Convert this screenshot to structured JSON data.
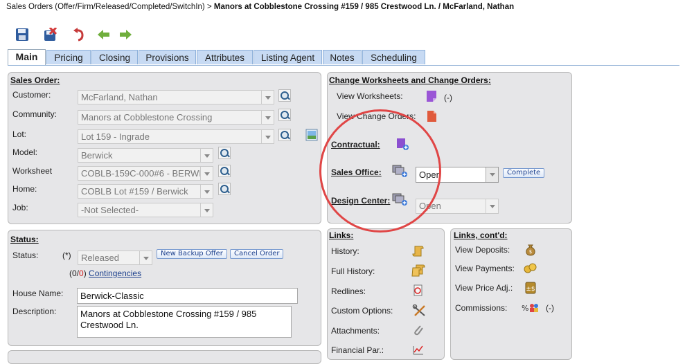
{
  "breadcrumb": {
    "prefix": "Sales Orders (Offer/Firm/Released/Completed/SwitchIn)",
    "sep": ">",
    "current": "Manors at Cobblestone Crossing #159 / 985 Crestwood Ln. / McFarland, Nathan"
  },
  "toolbar": {
    "icons": [
      "save-icon",
      "save-close-icon",
      "undo-icon",
      "back-arrow-icon",
      "forward-arrow-icon"
    ]
  },
  "tabs": [
    "Main",
    "Pricing",
    "Closing",
    "Provisions",
    "Attributes",
    "Listing Agent",
    "Notes",
    "Scheduling"
  ],
  "sales_order": {
    "title": "Sales Order:",
    "customer_label": "Customer:",
    "customer_value": "McFarland, Nathan",
    "community_label": "Community:",
    "community_value": "Manors at Cobblestone Crossing",
    "lot_label": "Lot:",
    "lot_value": "Lot 159 - Ingrade",
    "model_label": "Model:",
    "model_value": "Berwick",
    "worksheet_label": "Worksheet",
    "worksheet_value": "COBLB-159C-000#6 - BERWI(",
    "home_label": "Home:",
    "home_value": "COBLB Lot #159 / Berwick",
    "job_label": "Job:",
    "job_value": "-Not Selected-"
  },
  "status": {
    "title": "Status:",
    "status_label": "Status:",
    "required_mark": "(*)",
    "status_value": "Released",
    "new_backup_offer": "New Backup Offer",
    "cancel_order": "Cancel Order",
    "contingency_open": "(0/",
    "contingency_count": "0",
    "contingency_close": ")",
    "contingencies_link": "Contingencies",
    "house_name_label": "House Name:",
    "house_name_value": "Berwick-Classic",
    "description_label": "Description:",
    "description_value": "Manors at Cobblestone Crossing #159 / 985 Crestwood Ln."
  },
  "change": {
    "title": "Change Worksheets and Change Orders:",
    "view_worksheets": "View Worksheets:",
    "worksheets_count": "(-)",
    "view_change_orders": "View Change Orders:",
    "contractual": "Contractual:",
    "sales_office": "Sales Office:",
    "sales_office_value": "Open",
    "complete_button": "Complete",
    "design_center": "Design Center:",
    "design_center_value": "Open"
  },
  "links": {
    "title": "Links:",
    "items": [
      "History:",
      "Full History:",
      "Redlines:",
      "Custom Options:",
      "Attachments:",
      "Financial Par.:"
    ]
  },
  "links2": {
    "title": "Links, cont'd:",
    "view_deposits": "View Deposits:",
    "view_payments": "View Payments:",
    "view_price_adj": "View Price Adj.:",
    "commissions": "Commissions:",
    "commissions_value": "(-)"
  },
  "colors": {
    "tab_bg": "#c7daf3",
    "panel_bg": "#e6e6e8",
    "link": "#1a3e8c",
    "annotation_circle": "#e04646"
  }
}
